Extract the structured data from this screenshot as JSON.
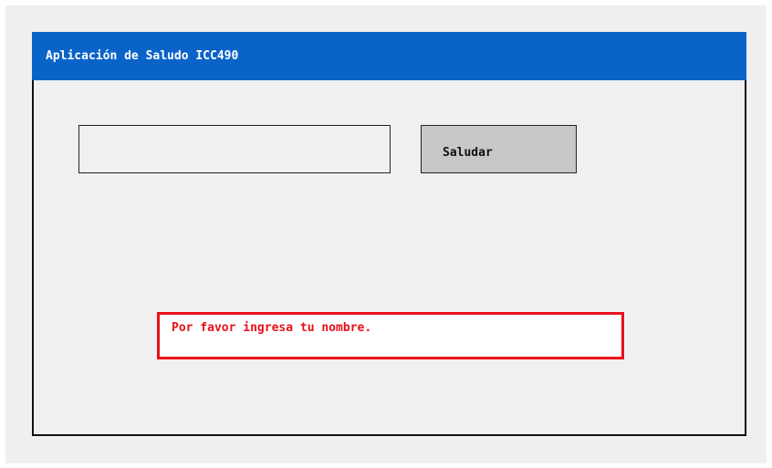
{
  "window": {
    "title": "Aplicación de Saludo ICC490"
  },
  "form": {
    "name_input_value": "",
    "name_input_placeholder": "",
    "greet_button_label": "Saludar"
  },
  "message": {
    "text": "Por favor ingresa tu nombre."
  },
  "colors": {
    "titlebar": "#0a64c8",
    "error": "#e8101a",
    "button": "#c8c8c8",
    "background": "#f0f0f0"
  }
}
